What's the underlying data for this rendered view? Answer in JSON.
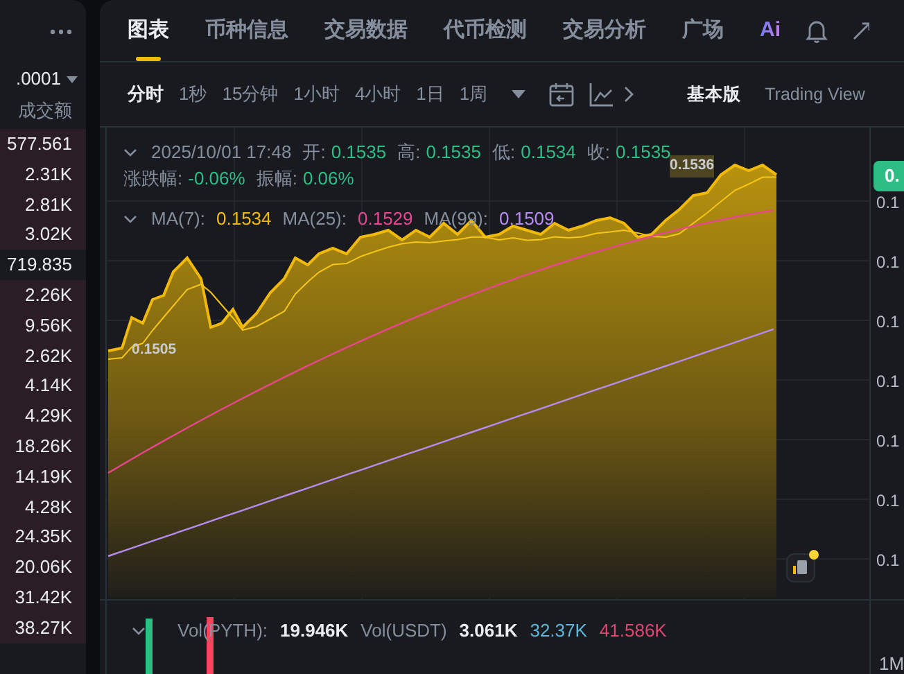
{
  "order_book": {
    "precision": ".0001",
    "column": "成交额",
    "rows": [
      {
        "value": "577.561",
        "selected": false
      },
      {
        "value": "2.31K",
        "selected": false
      },
      {
        "value": "2.81K",
        "selected": false
      },
      {
        "value": "3.02K",
        "selected": false
      },
      {
        "value": "719.835",
        "selected": true
      },
      {
        "value": "2.26K",
        "selected": false
      },
      {
        "value": "9.56K",
        "selected": false
      },
      {
        "value": "2.62K",
        "selected": false
      },
      {
        "value": "4.14K",
        "selected": false
      },
      {
        "value": "4.29K",
        "selected": false
      },
      {
        "value": "18.26K",
        "selected": false
      },
      {
        "value": "14.19K",
        "selected": false
      },
      {
        "value": "4.28K",
        "selected": false
      },
      {
        "value": "24.35K",
        "selected": false
      },
      {
        "value": "20.06K",
        "selected": false
      },
      {
        "value": "31.42K",
        "selected": false
      },
      {
        "value": "38.27K",
        "selected": false
      }
    ]
  },
  "tabs": [
    {
      "label": "图表",
      "selected": true
    },
    {
      "label": "币种信息",
      "selected": false
    },
    {
      "label": "交易数据",
      "selected": false
    },
    {
      "label": "代币检测",
      "selected": false
    },
    {
      "label": "交易分析",
      "selected": false
    },
    {
      "label": "广场",
      "selected": false
    }
  ],
  "ai_label": "Ai",
  "intervals": [
    {
      "label": "分时",
      "selected": true
    },
    {
      "label": "1秒",
      "selected": false
    },
    {
      "label": "15分钟",
      "selected": false
    },
    {
      "label": "1小时",
      "selected": false
    },
    {
      "label": "4小时",
      "selected": false
    },
    {
      "label": "1日",
      "selected": false
    },
    {
      "label": "1周",
      "selected": false
    }
  ],
  "views": [
    {
      "label": "基本版",
      "selected": true
    },
    {
      "label": "Trading View",
      "selected": false
    }
  ],
  "legend": {
    "time": "2025/10/01 17:48",
    "fields": [
      {
        "label": "开:",
        "value": "0.1535"
      },
      {
        "label": "高:",
        "value": "0.1535"
      },
      {
        "label": "低:",
        "value": "0.1534"
      },
      {
        "label": "收:",
        "value": "0.1535"
      },
      {
        "label": "涨跌幅:",
        "value": "-0.06%"
      },
      {
        "label": "振幅:",
        "value": "0.06%"
      }
    ],
    "indicators": [
      {
        "label": "MA(7):",
        "value": "0.1534",
        "color": "#f0b90b"
      },
      {
        "label": "MA(25):",
        "value": "0.1529",
        "color": "#e8468f"
      },
      {
        "label": "MA(99):",
        "value": "0.1509",
        "color": "#b78cf2"
      }
    ]
  },
  "price_markers": [
    {
      "kind": "low",
      "label": "0.1505"
    },
    {
      "kind": "high",
      "label": "0.1536"
    }
  ],
  "price_axis": {
    "current": "0.",
    "ticks": [
      "0.1",
      "0.1",
      "0.1",
      "0.1",
      "0.1",
      "0.1",
      "0.1"
    ]
  },
  "volume": {
    "items": [
      {
        "label": "Vol(PYTH):",
        "value": "19.946K",
        "color": "#eaecef"
      },
      {
        "label": "Vol(USDT)",
        "value": "3.061K",
        "color": "#eaecef"
      },
      {
        "value": "32.37K",
        "color": "#5fb6d8"
      },
      {
        "value": "41.586K",
        "color": "#e0456f"
      }
    ],
    "axis_label": "1M"
  }
}
